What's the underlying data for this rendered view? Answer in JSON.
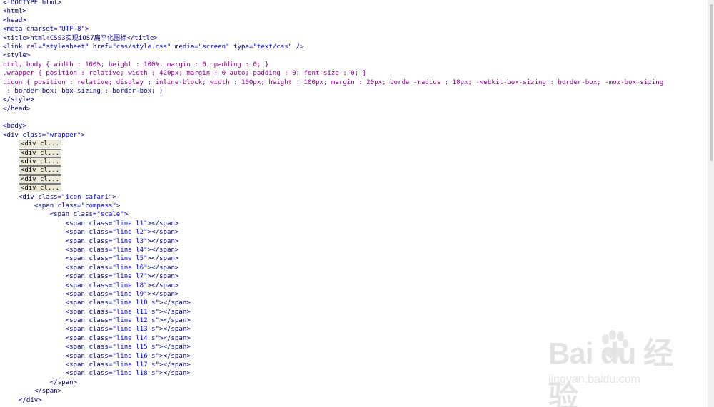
{
  "code_lines": [
    "<!DOCTYPE html>",
    "<html>",
    "<head>",
    "<meta charset=\"UTF-8\">",
    "<title>html+CSS3实现iOS7扁平化图标</title>",
    "<link rel=\"stylesheet\" href=\"css/style.css\" media=\"screen\" type=\"text/css\" />",
    "<style>",
    "html, body { width : 100%; height : 100%; margin : 0; padding : 0; }",
    ".wrapper { position : relative; width : 420px; margin : 0 auto; padding : 0; font-size : 0; }",
    ".icon { position : relative; display : inline-block; width : 100px; height : 100px; margin : 20px; border-radius : 18px; -webkit-box-sizing : border-box; -moz-box-sizing",
    " : border-box; box-sizing : border-box; }",
    "</style>",
    "</head>",
    "",
    "<body>",
    "<div class=\"wrapper\">",
    "",
    "",
    "",
    "",
    "",
    "",
    "    <div class=\"icon safari\">",
    "        <span class=\"compass\">",
    "            <span class=\"scale\">",
    "                <span class=\"line l1\"></span>",
    "                <span class=\"line l2\"></span>",
    "                <span class=\"line l3\"></span>",
    "                <span class=\"line l4\"></span>",
    "                <span class=\"line l5\"></span>",
    "                <span class=\"line l6\"></span>",
    "                <span class=\"line l7\"></span>",
    "                <span class=\"line l8\"></span>",
    "                <span class=\"line l9\"></span>",
    "                <span class=\"line l10 s\"></span>",
    "                <span class=\"line l11 s\"></span>",
    "                <span class=\"line l12 s\"></span>",
    "                <span class=\"line l13 s\"></span>",
    "                <span class=\"line l14 s\"></span>",
    "                <span class=\"line l15 s\"></span>",
    "                <span class=\"line l16 s\"></span>",
    "                <span class=\"line l17 s\"></span>",
    "                <span class=\"line l18 s\"></span>",
    "            </span>",
    "        </span>",
    "    </div>"
  ],
  "collapsed_label": "<div cl...",
  "collapsed_rows": [
    16,
    17,
    18,
    19,
    20,
    21
  ],
  "watermark": {
    "logo": "Bai du 经验",
    "url": "jingyan.baidu.com"
  }
}
